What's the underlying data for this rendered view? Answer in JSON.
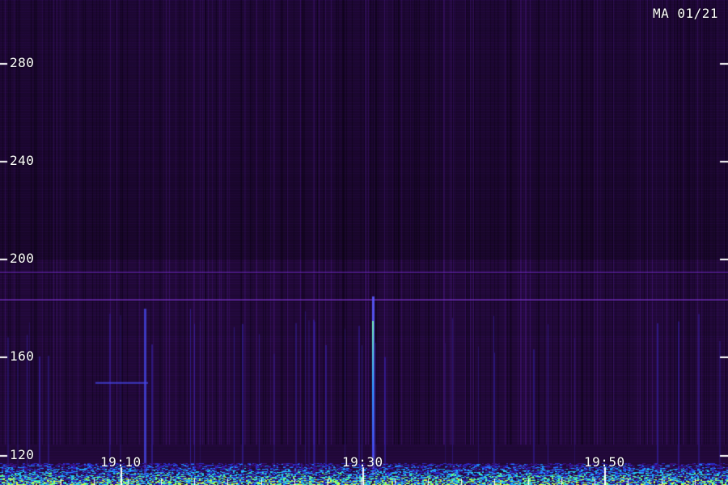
{
  "station_label": "MA 01/21",
  "chart_data": {
    "type": "heatmap",
    "title": "",
    "xlabel": "",
    "ylabel": "",
    "ylim": [
      108,
      306
    ],
    "yticks": [
      120,
      160,
      200,
      240,
      280
    ],
    "ytick_labels": [
      "120",
      "160",
      "200",
      "240",
      "280"
    ],
    "xticks": [
      "19:10",
      "19:30",
      "19:50"
    ],
    "minor_x_ticks": 21,
    "background": "#1e0833",
    "colormap": [
      "#1e0833",
      "#3a0e7a",
      "#2b2bcc",
      "#1e90ff",
      "#22ccee",
      "#66ff88",
      "#ccff44"
    ],
    "features": {
      "horizontal_band_values": [
        195,
        184
      ],
      "vertical_streak_times": [
        "19:31"
      ],
      "broadband_noise_below": 117
    }
  }
}
